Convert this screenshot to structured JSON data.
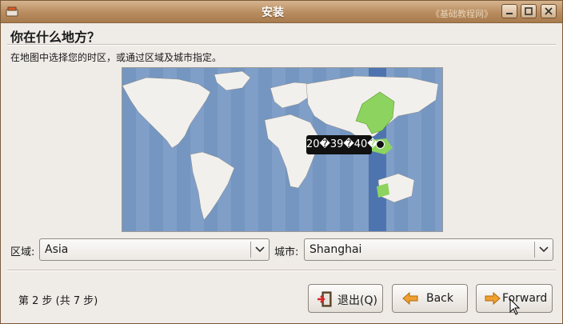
{
  "window": {
    "title": "安装",
    "watermark": "《基础教程网》"
  },
  "page": {
    "heading": "你在什么地方？",
    "instruction": "在地图中选择您的时区，或通过区域及城市指定。"
  },
  "map": {
    "time_tooltip": "20�39�40�",
    "selected_city": "Shanghai",
    "highlight_color": "#8dd35f",
    "ocean_color": "#7f9fc8",
    "land_color": "#f2f0ed"
  },
  "region": {
    "label": "区域:",
    "value": "Asia"
  },
  "city": {
    "label": "城市:",
    "value": "Shanghai"
  },
  "footer": {
    "step": "第 2 步 (共 7 步)",
    "quit_label": "退出(Q)",
    "back_label": "Back",
    "forward_label": "Forward"
  }
}
